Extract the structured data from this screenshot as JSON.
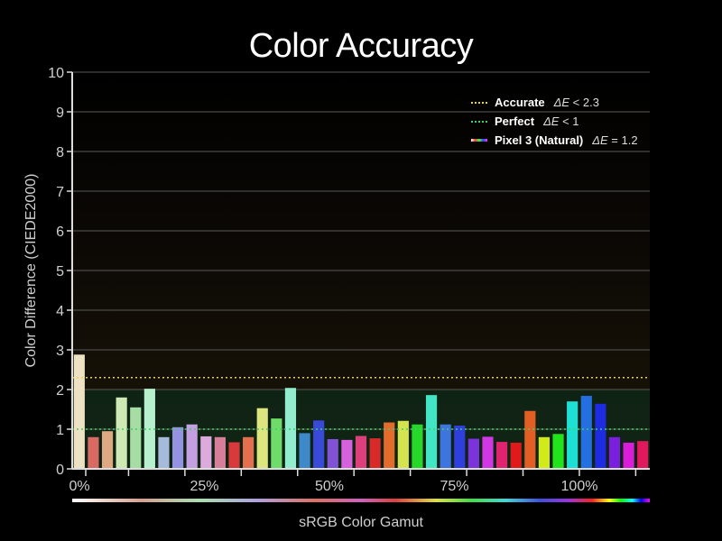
{
  "chart_data": {
    "type": "bar",
    "title": "Color Accuracy",
    "xlabel": "sRGB Color Gamut",
    "ylabel": "Color Difference (CIEDE2000)",
    "ylim": [
      0,
      10
    ],
    "yticks": [
      "0",
      "1",
      "2",
      "3",
      "4",
      "5",
      "6",
      "7",
      "8",
      "9",
      "10"
    ],
    "xticks": [
      "0%",
      "25%",
      "50%",
      "75%",
      "100%"
    ],
    "grid": true,
    "legend_position": "top-right",
    "thresholds": [
      {
        "label": "Accurate",
        "expr_var": "ΔE",
        "expr_rest": " < 2.3",
        "value": 2.3,
        "color": "#e8d24a"
      },
      {
        "label": "Perfect",
        "expr_var": "ΔE",
        "expr_rest": " < 1",
        "value": 1,
        "color": "#3fd06a"
      }
    ],
    "series": [
      {
        "name": "Pixel 3 (Natural)",
        "summary_var": "ΔE",
        "summary_rest": " = 1.2",
        "values": [
          2.88,
          0.8,
          0.95,
          1.8,
          1.55,
          2.02,
          0.8,
          1.05,
          1.12,
          0.82,
          0.8,
          0.67,
          0.8,
          1.53,
          1.27,
          2.04,
          0.9,
          1.22,
          0.75,
          0.73,
          0.83,
          0.77,
          1.17,
          1.21,
          1.12,
          1.86,
          1.12,
          1.09,
          0.76,
          0.81,
          0.68,
          0.66,
          1.46,
          0.8,
          0.88,
          1.7,
          1.84,
          1.64,
          0.8,
          0.66,
          0.7
        ]
      }
    ],
    "bar_colors": [
      "#ede2c4",
      "#d86a63",
      "#dea883",
      "#cfe9b4",
      "#a5dda4",
      "#b6f0cc",
      "#a6bad9",
      "#9393e2",
      "#c4a0e2",
      "#ddaadd",
      "#d67f9a",
      "#d8393b",
      "#e46f4e",
      "#dde57e",
      "#6fdb6b",
      "#92ecce",
      "#3e89c9",
      "#3949d8",
      "#8151d6",
      "#d561dc",
      "#dd3f7b",
      "#d92a2a",
      "#e36c2c",
      "#d5e34e",
      "#27d82b",
      "#42e6c4",
      "#3d74de",
      "#2f3fde",
      "#7b34dc",
      "#d137e3",
      "#e0236e",
      "#e01a1b",
      "#e35e24",
      "#d3ea19",
      "#21e51a",
      "#1ddfd3",
      "#2470e0",
      "#1d2ce0",
      "#7a1fde",
      "#d91dd9",
      "#e0185c"
    ],
    "x_positions": [
      0.0,
      0.025,
      0.05,
      0.075,
      0.1,
      0.125,
      0.15,
      0.175,
      0.2,
      0.225,
      0.25,
      0.275,
      0.3,
      0.325,
      0.35,
      0.375,
      0.4,
      0.425,
      0.45,
      0.475,
      0.5,
      0.525,
      0.55,
      0.575,
      0.6,
      0.625,
      0.65,
      0.675,
      0.7,
      0.725,
      0.75,
      0.775,
      0.8,
      0.825,
      0.85,
      0.875,
      0.9,
      0.925,
      0.95,
      0.975,
      1.0
    ]
  }
}
